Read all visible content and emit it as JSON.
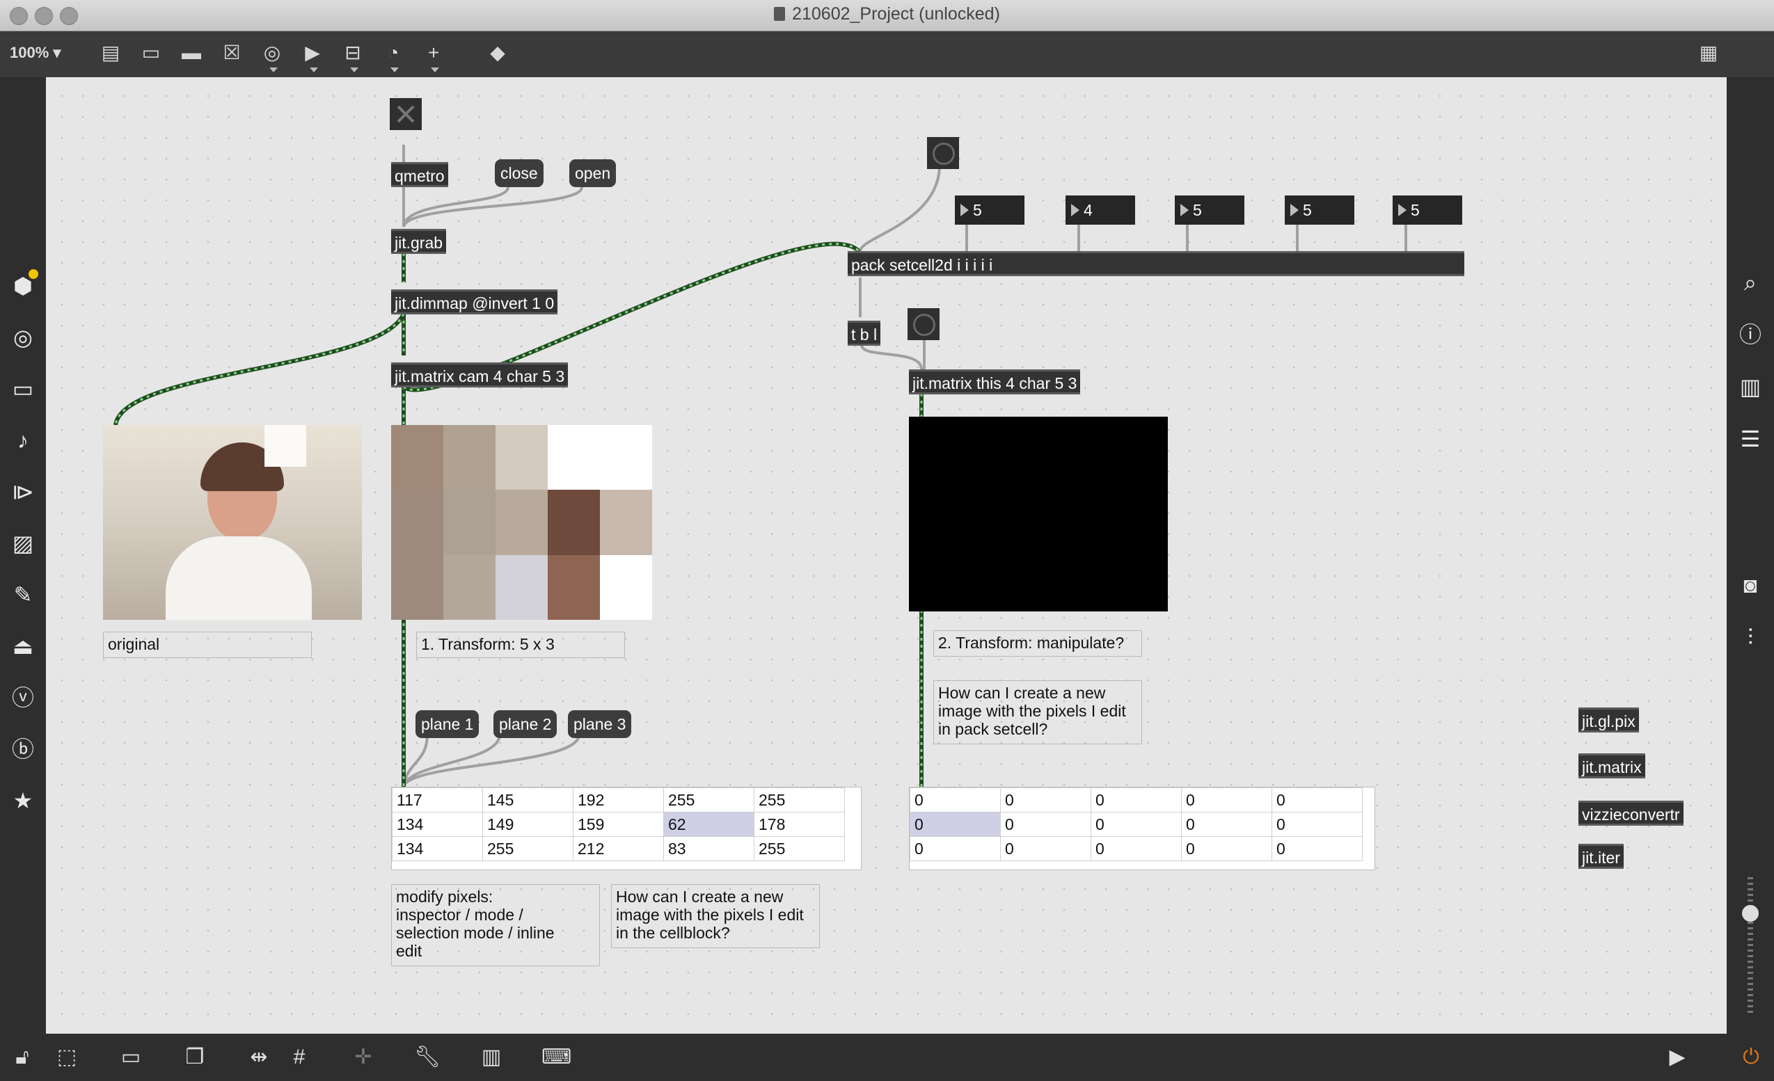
{
  "window": {
    "title": "210602_Project (unlocked)"
  },
  "toolbar": {
    "zoom": "100%",
    "icons": [
      "presentation-icon",
      "message-icon",
      "comment-icon",
      "toggle-icon",
      "button-icon",
      "number-icon",
      "slider-icon",
      "dial-icon",
      "add-icon",
      "paint-bucket-icon"
    ],
    "grid_icon": "grid-icon"
  },
  "left_sidebar": [
    "packages-icon",
    "target-icon",
    "film-icon",
    "music-note-icon",
    "media-icon",
    "image-icon",
    "paperclip-icon",
    "plugin-icon",
    "v-icon",
    "b-icon",
    "star-icon"
  ],
  "right_sidebar": [
    "search-icon",
    "info-icon",
    "columns-icon",
    "list-icon",
    "camera-icon",
    "mixer-icon"
  ],
  "bottom_bar": [
    "lock-icon",
    "select-icon",
    "presentation-icon",
    "layers-icon",
    "align-icon",
    "grid-icon",
    "snap-icon",
    "wrench-icon",
    "piano-icon",
    "keyboard-icon",
    "play-icon",
    "power-icon"
  ],
  "patch": {
    "objects": {
      "qmetro": "qmetro",
      "jit_grab": "jit.grab",
      "dimmap": "jit.dimmap @invert 1 0",
      "matrix_cam": "jit.matrix cam 4 char 5 3",
      "pack": "pack setcell2d i i i i i",
      "tbl": "t b l",
      "matrix_this": "jit.matrix this 4 char 5 3",
      "jit_gl_pix": "jit.gl.pix",
      "jit_matrix": "jit.matrix",
      "vizzieconvertr": "vizzieconvertr",
      "jit_iter": "jit.iter"
    },
    "messages": {
      "close": "close",
      "open": "open",
      "plane1": "plane 1",
      "plane2": "plane 2",
      "plane3": "plane 3"
    },
    "numbers": [
      "5",
      "4",
      "5",
      "5",
      "5"
    ],
    "comments": {
      "original": "original",
      "transform1": "1. Transform: 5 x 3",
      "transform2": "2. Transform: manipulate?",
      "question_pack": "How can I create a new\nimage with the pixels I edit\nin pack setcell?",
      "modify": "modify pixels:\ninspector / mode /\nselection mode /  inline\nedit",
      "question_cell": "How can I create a new\nimage with the pixels I edit\nin the cellblock?"
    },
    "cellblock_left": [
      [
        "117",
        "145",
        "192",
        "255",
        "255"
      ],
      [
        "134",
        "149",
        "159",
        "62",
        "178"
      ],
      [
        "134",
        "255",
        "212",
        "83",
        "255"
      ]
    ],
    "cellblock_right": [
      [
        "0",
        "0",
        "0",
        "0",
        "0"
      ],
      [
        "0",
        "0",
        "0",
        "0",
        "0"
      ],
      [
        "0",
        "0",
        "0",
        "0",
        "0"
      ]
    ],
    "pixel_grid_colors": [
      [
        "#a08978",
        "#b0a192",
        "#d4cbc0",
        "#ffffff",
        "#ffffff"
      ],
      [
        "#9e8a7c",
        "#ada094",
        "#b7a99c",
        "#6e4a3c",
        "#c7b9ae"
      ],
      [
        "#9e8a7c",
        "#b3a79c",
        "#d2d2d8",
        "#8e6452",
        "#ffffff"
      ]
    ],
    "colors": {
      "canvas": "#e6e6e6",
      "object": "#333333",
      "cable_jitter": "#2a6b2a",
      "cable_plain": "#a0a0a0",
      "selected_cell": "#cfd0e6"
    }
  }
}
